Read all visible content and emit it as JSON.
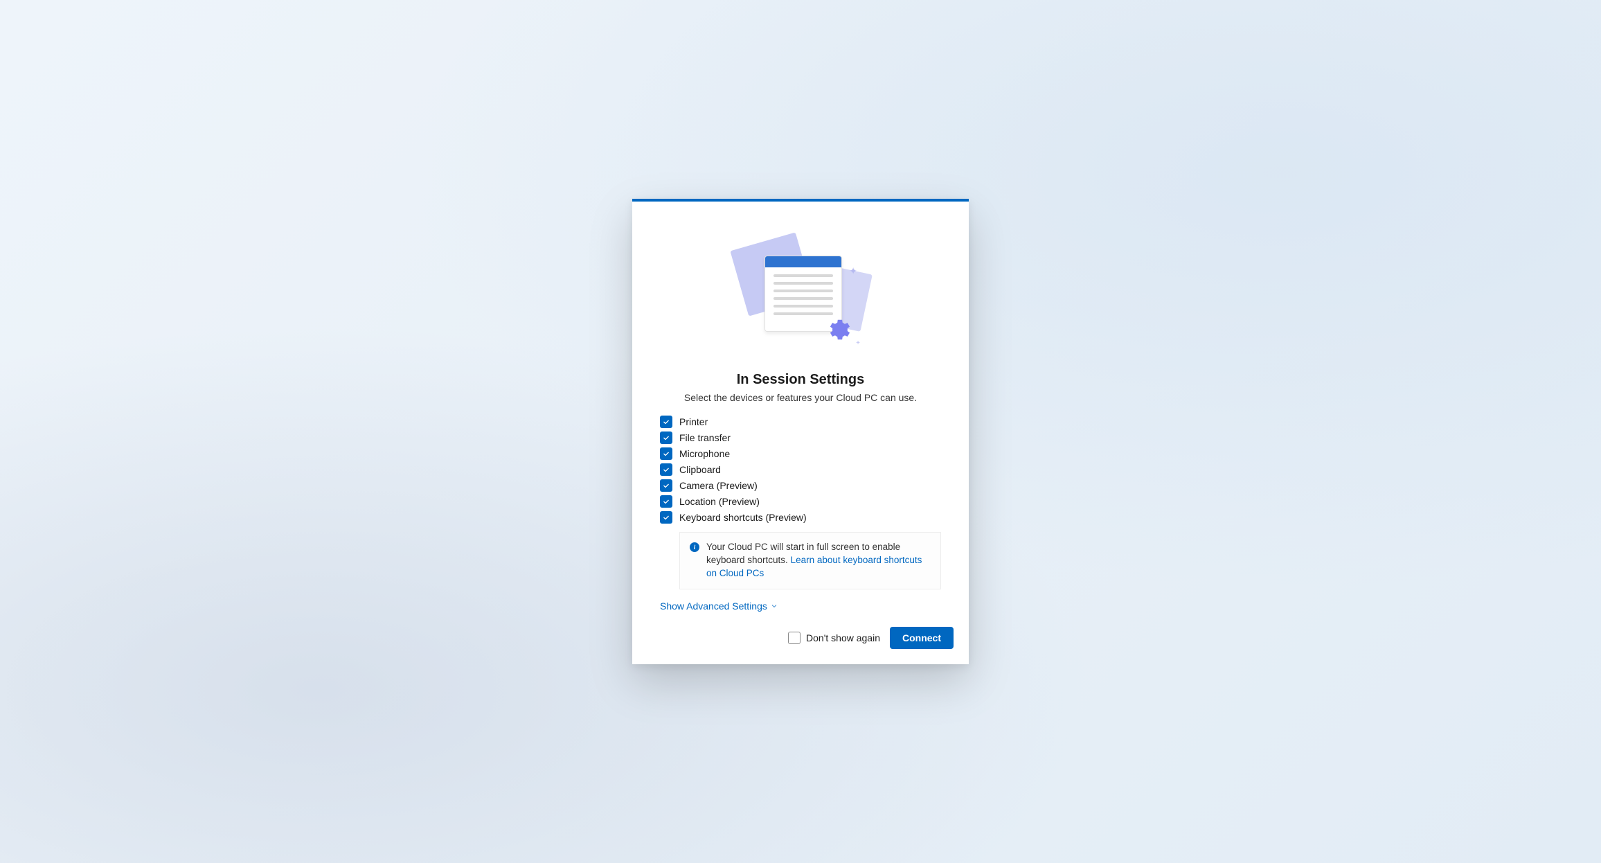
{
  "colors": {
    "accent": "#0067c0",
    "illus_light": "#d3d6f6",
    "illus_mid": "#c6caf4",
    "gear": "#7b7ff0"
  },
  "dialog": {
    "title": "In Session Settings",
    "subtitle": "Select the devices or features your Cloud PC can use.",
    "options": [
      {
        "label": "Printer",
        "checked": true
      },
      {
        "label": "File transfer",
        "checked": true
      },
      {
        "label": "Microphone",
        "checked": true
      },
      {
        "label": "Clipboard",
        "checked": true
      },
      {
        "label": "Camera (Preview)",
        "checked": true
      },
      {
        "label": "Location (Preview)",
        "checked": true
      },
      {
        "label": "Keyboard shortcuts (Preview)",
        "checked": true
      }
    ],
    "info": {
      "text": "Your Cloud PC will start in full screen to enable keyboard shortcuts. ",
      "link_text": "Learn about keyboard shortcuts on Cloud PCs"
    },
    "advanced_label": "Show Advanced Settings",
    "footer": {
      "dont_show_label": "Don't show again",
      "dont_show_checked": false,
      "connect_label": "Connect"
    }
  }
}
